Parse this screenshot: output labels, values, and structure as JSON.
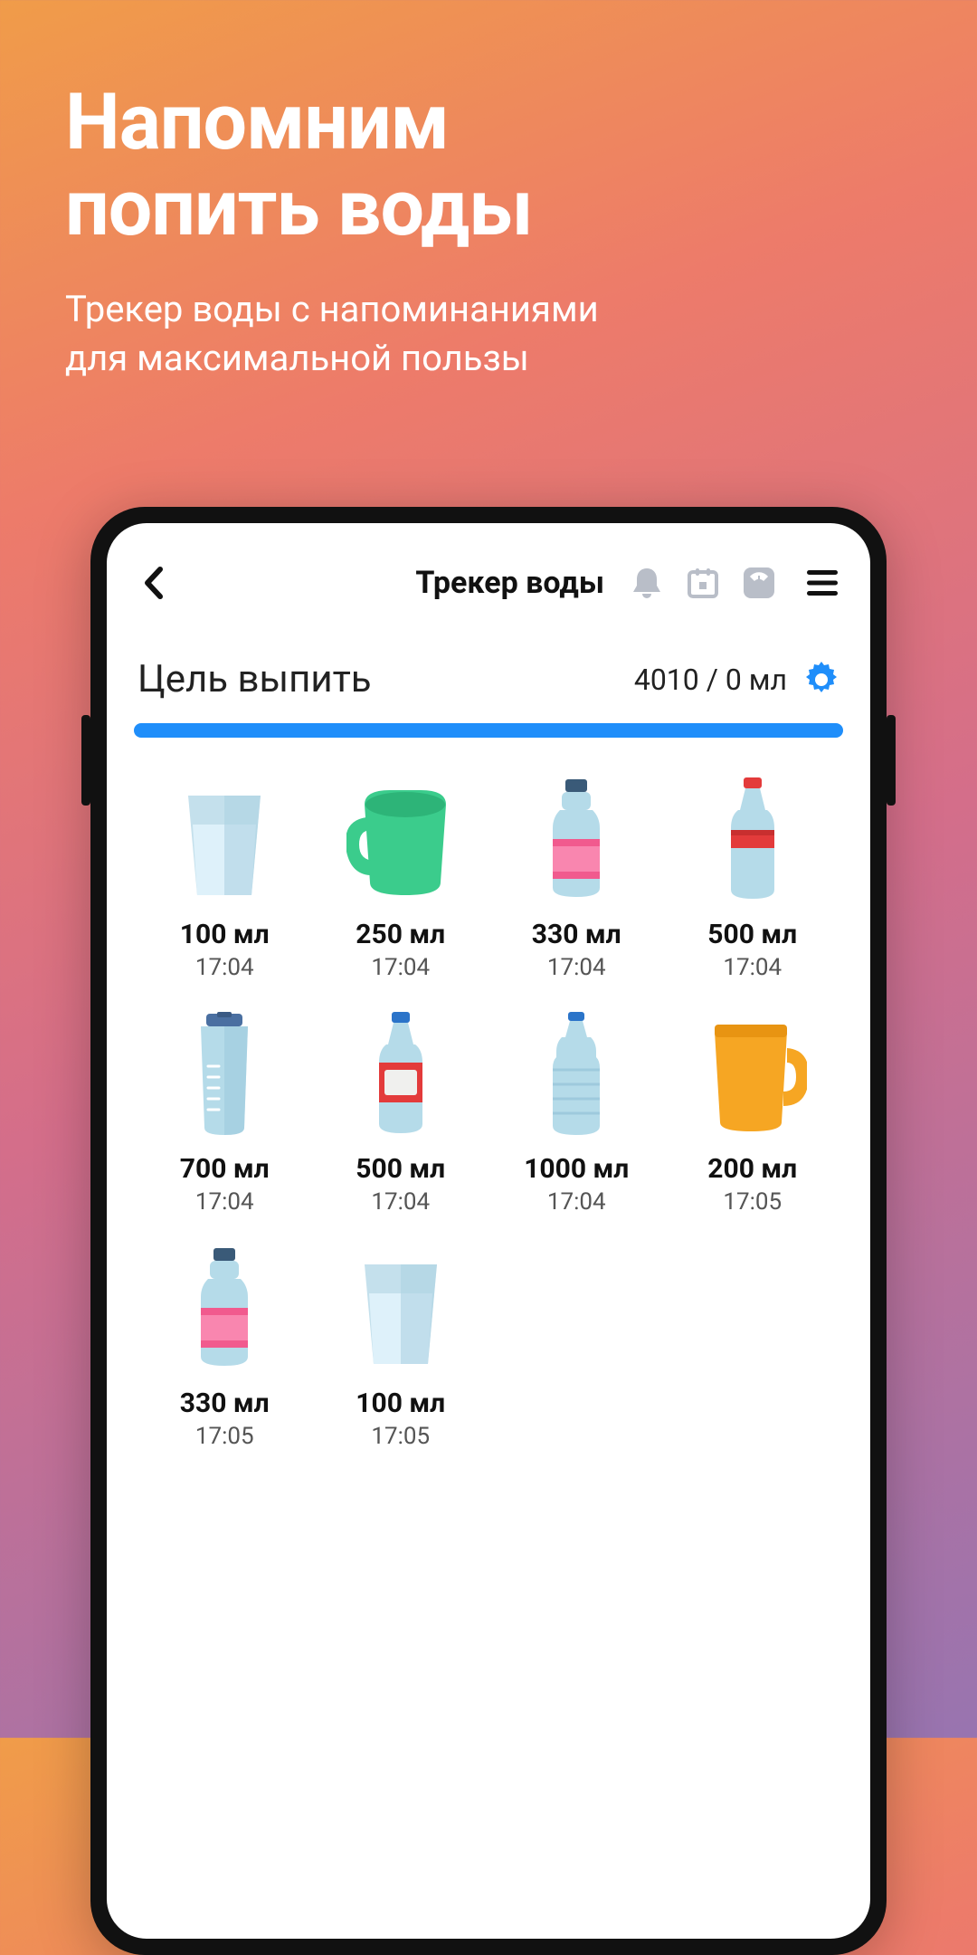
{
  "promo": {
    "title_line1": "Напомним",
    "title_line2": "попить воды",
    "subtitle_line1": "Трекер воды с напоминаниями",
    "subtitle_line2": "для максимальной пользы"
  },
  "app": {
    "title": "Трекер воды",
    "goal_label": "Цель выпить",
    "goal_value": "4010 / 0 мл",
    "entries": [
      {
        "amount": "100 мл",
        "time": "17:04",
        "icon": "glass"
      },
      {
        "amount": "250 мл",
        "time": "17:04",
        "icon": "mug-green"
      },
      {
        "amount": "330 мл",
        "time": "17:04",
        "icon": "bottle-pink"
      },
      {
        "amount": "500 мл",
        "time": "17:04",
        "icon": "bottle-red"
      },
      {
        "amount": "700 мл",
        "time": "17:04",
        "icon": "shaker"
      },
      {
        "amount": "500 мл",
        "time": "17:04",
        "icon": "bottle-label"
      },
      {
        "amount": "1000 мл",
        "time": "17:04",
        "icon": "bottle-large"
      },
      {
        "amount": "200 мл",
        "time": "17:05",
        "icon": "mug-orange"
      },
      {
        "amount": "330 мл",
        "time": "17:05",
        "icon": "bottle-pink"
      },
      {
        "amount": "100 мл",
        "time": "17:05",
        "icon": "glass"
      }
    ]
  },
  "colors": {
    "accent": "#1f8efa",
    "iconGrey": "#b9bec8"
  }
}
